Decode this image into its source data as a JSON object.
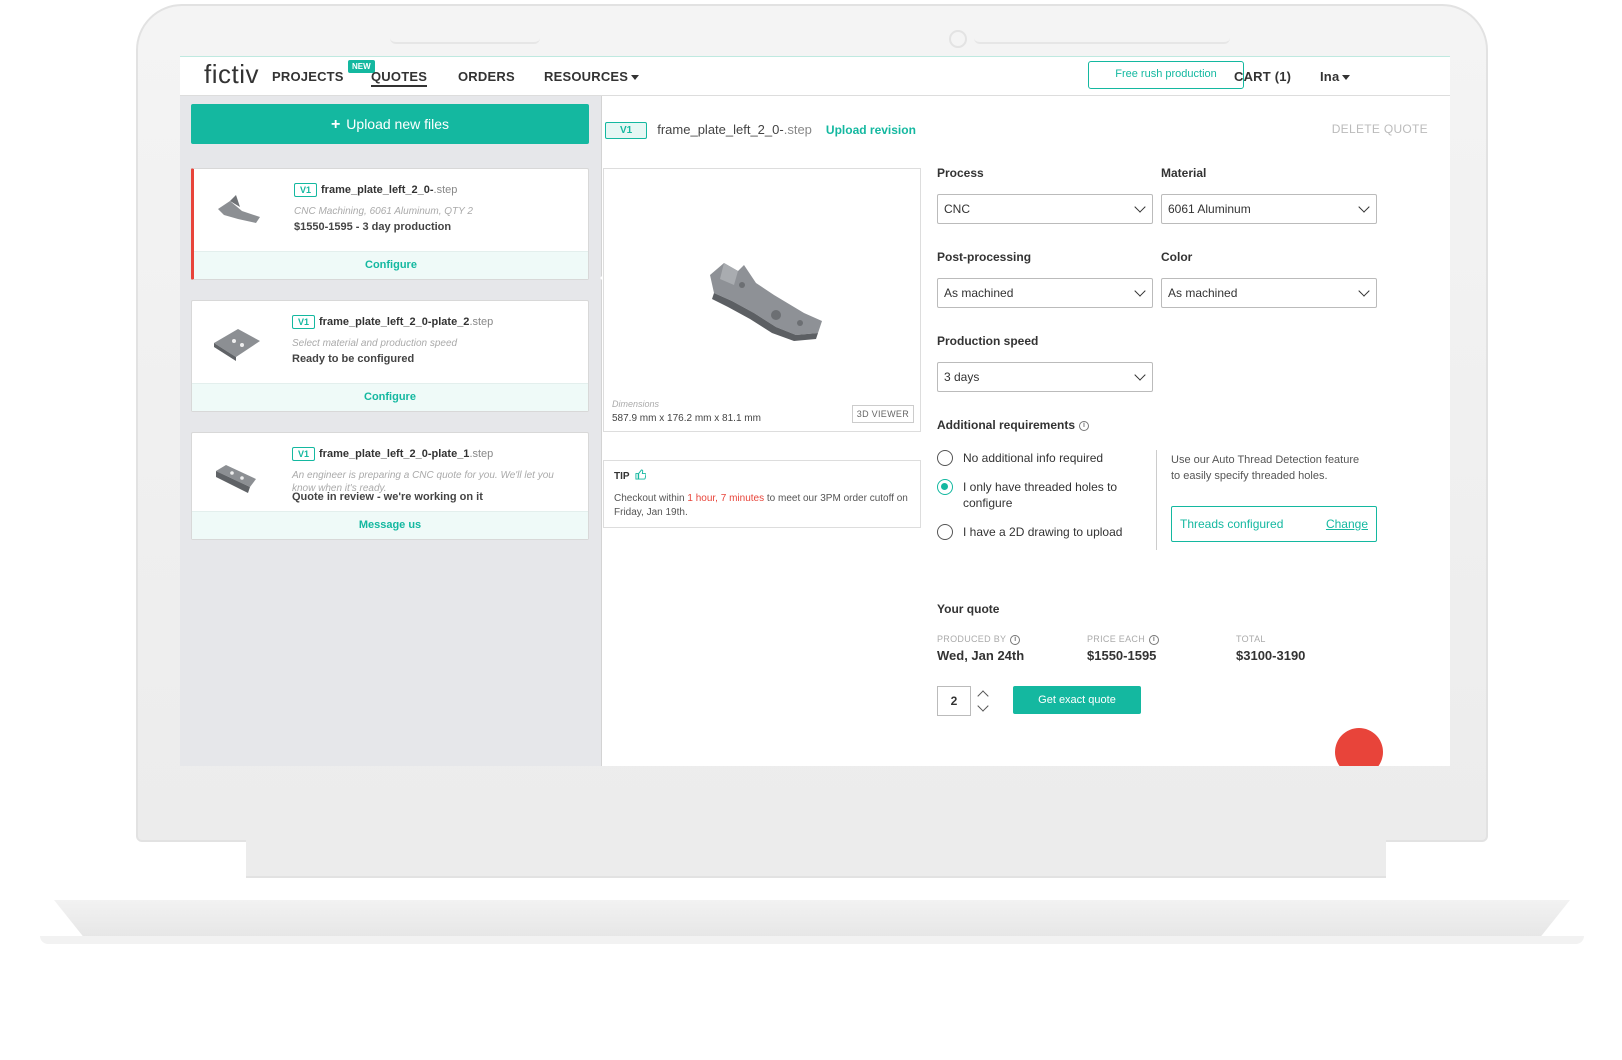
{
  "nav": {
    "logo": "fictiv",
    "projects": "PROJECTS",
    "new_badge": "NEW",
    "quotes": "QUOTES",
    "orders": "ORDERS",
    "resources": "RESOURCES",
    "rush_button": "Free rush production",
    "cart": "CART (1)",
    "user": "Ina"
  },
  "sidebar": {
    "upload_button": "Upload new files",
    "files": [
      {
        "version": "V1",
        "name": "frame_plate_left_2_0-",
        "ext": ".step",
        "subtitle": "CNC Machining, 6061 Aluminum, QTY 2",
        "status": "$1550-1595 - 3 day production",
        "action": "Configure"
      },
      {
        "version": "V1",
        "name": "frame_plate_left_2_0-plate_2",
        "ext": ".step",
        "subtitle": "Select material and production speed",
        "status": "Ready to be configured",
        "action": "Configure"
      },
      {
        "version": "V1",
        "name": "frame_plate_left_2_0-plate_1",
        "ext": ".step",
        "subtitle": "An engineer is preparing a CNC quote for you. We'll let you know when it's ready.",
        "status": "Quote in review - we're working on it",
        "action": "Message us"
      }
    ]
  },
  "detail": {
    "version": "V1",
    "filename": "frame_plate_left_2_0-",
    "ext": ".step",
    "upload_revision": "Upload revision",
    "delete_quote": "DELETE QUOTE",
    "dimensions_label": "Dimensions",
    "dimensions_value": "587.9 mm x 176.2 mm x 81.1 mm",
    "viewer_button": "3D VIEWER",
    "tip": {
      "title": "TIP",
      "text_before": "Checkout within ",
      "highlight": "1 hour, 7 minutes",
      "text_after": " to meet our 3PM order cutoff on Friday, Jan 19th."
    }
  },
  "config": {
    "process_label": "Process",
    "process_value": "CNC",
    "material_label": "Material",
    "material_value": "6061 Aluminum",
    "postproc_label": "Post-processing",
    "postproc_value": "As machined",
    "color_label": "Color",
    "color_value": "As machined",
    "speed_label": "Production speed",
    "speed_value": "3 days",
    "requirements_label": "Additional requirements",
    "requirements": [
      {
        "label": "No additional info required",
        "checked": false
      },
      {
        "label": "I only have threaded holes to configure",
        "checked": true
      },
      {
        "label": "I have a 2D drawing to upload",
        "checked": false
      }
    ],
    "thread_help": "Use our Auto Thread Detection feature to easily specify threaded holes.",
    "threads_status": "Threads configured",
    "threads_change": "Change"
  },
  "quote": {
    "title": "Your quote",
    "produced_by_label": "PRODUCED BY",
    "produced_by_value": "Wed, Jan 24th",
    "price_each_label": "PRICE EACH",
    "price_each_value": "$1550-1595",
    "total_label": "TOTAL",
    "total_value": "$3100-3190",
    "quantity": "2",
    "exact_quote_button": "Get exact quote"
  },
  "colors": {
    "accent": "#14b8a0",
    "alert": "#e8443a"
  }
}
